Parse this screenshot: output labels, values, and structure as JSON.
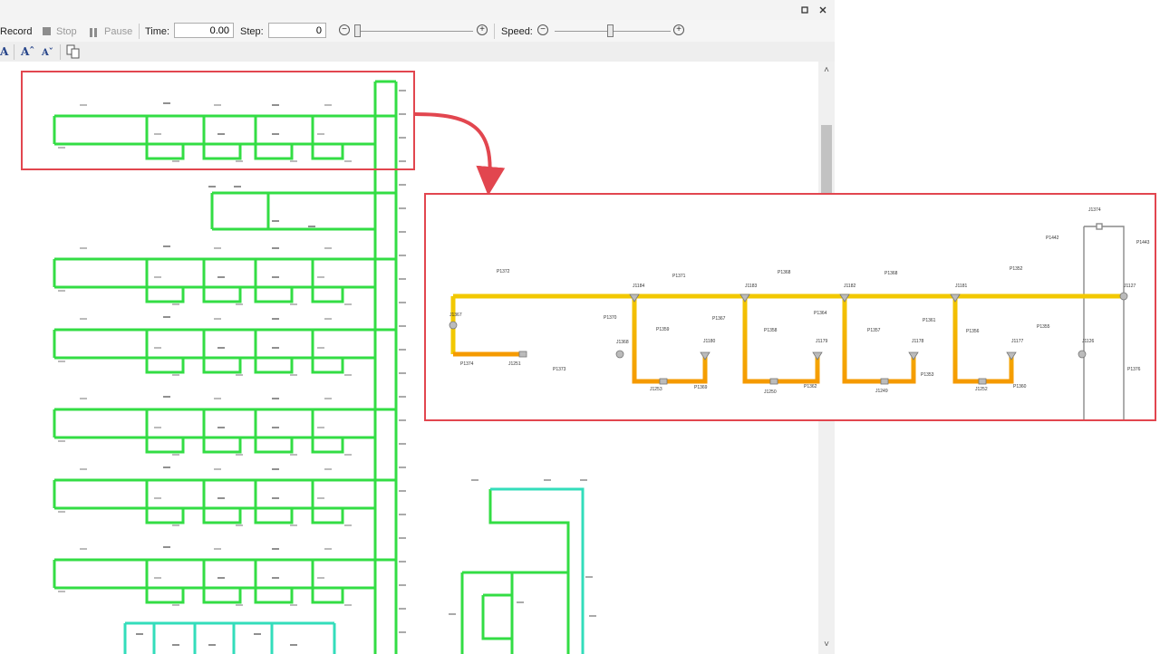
{
  "toolbar": {
    "record_label": "Record",
    "stop_label": "Stop",
    "pause_label": "Pause",
    "time_label": "Time:",
    "time_value": "0.00",
    "step_label": "Step:",
    "step_value": "0",
    "speed_label": "Speed:"
  },
  "icons": {
    "stop": "stop-icon",
    "pause": "pause-icon",
    "zoom_out": "minus-circle-icon",
    "zoom_in": "plus-circle-icon",
    "copy": "copy-icon",
    "restore": "restore-icon",
    "close": "close-icon"
  },
  "colors": {
    "network_green": "#33dd44",
    "network_teal": "#33ddbb",
    "highlight_red": "#e2464f",
    "pipe_yellow": "#f2c800",
    "pipe_orange": "#f59a00",
    "pipe_red": "#e3360e",
    "pipe_gray": "#8a8a8a"
  },
  "callout": {
    "labels": [
      {
        "id": "J1374",
        "t": "J1374"
      },
      {
        "id": "P1442",
        "t": "P1442"
      },
      {
        "id": "P1443",
        "t": "P1443"
      },
      {
        "id": "P1372",
        "t": "P1372"
      },
      {
        "id": "P1371",
        "t": "P1371"
      },
      {
        "id": "P1368a",
        "t": "P1368"
      },
      {
        "id": "P1368b",
        "t": "P1368"
      },
      {
        "id": "P1352",
        "t": "P1352"
      },
      {
        "id": "J1184",
        "t": "J1184"
      },
      {
        "id": "J1183",
        "t": "J1183"
      },
      {
        "id": "J1182",
        "t": "J1182"
      },
      {
        "id": "J1181",
        "t": "J1181"
      },
      {
        "id": "J1127",
        "t": "J1127"
      },
      {
        "id": "J1367",
        "t": "J1367"
      },
      {
        "id": "P1370",
        "t": "P1370"
      },
      {
        "id": "P1367",
        "t": "P1367"
      },
      {
        "id": "P1364",
        "t": "P1364"
      },
      {
        "id": "P1361",
        "t": "P1361"
      },
      {
        "id": "P1355",
        "t": "P1355"
      },
      {
        "id": "P1359",
        "t": "P1359"
      },
      {
        "id": "P1358",
        "t": "P1358"
      },
      {
        "id": "P1357",
        "t": "P1357"
      },
      {
        "id": "P1356",
        "t": "P1356"
      },
      {
        "id": "J1368",
        "t": "J1368"
      },
      {
        "id": "J1180",
        "t": "J1180"
      },
      {
        "id": "J1179",
        "t": "J1179"
      },
      {
        "id": "J1178",
        "t": "J1178"
      },
      {
        "id": "J1177",
        "t": "J1177"
      },
      {
        "id": "J1126",
        "t": "J1126"
      },
      {
        "id": "P1374",
        "t": "P1374"
      },
      {
        "id": "J1251",
        "t": "J1251"
      },
      {
        "id": "P1373",
        "t": "P1373"
      },
      {
        "id": "P1353",
        "t": "P1353"
      },
      {
        "id": "P1376",
        "t": "P1376"
      },
      {
        "id": "J1253",
        "t": "J1253"
      },
      {
        "id": "P1369",
        "t": "P1369"
      },
      {
        "id": "J1250",
        "t": "J1250"
      },
      {
        "id": "P1362",
        "t": "P1362"
      },
      {
        "id": "J1249",
        "t": "J1249"
      },
      {
        "id": "J1252",
        "t": "J1252"
      },
      {
        "id": "P1360",
        "t": "P1360"
      }
    ]
  }
}
